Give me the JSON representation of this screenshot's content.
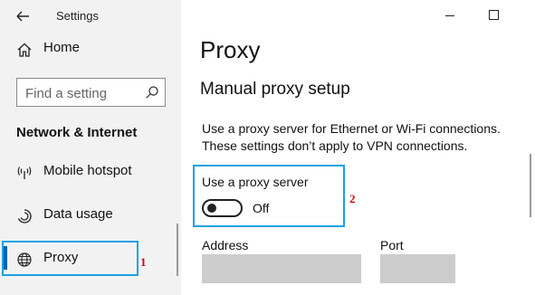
{
  "window": {
    "title": "Settings",
    "controls": {
      "minimize_icon": "minimize-icon",
      "maximize_icon": "maximize-icon"
    }
  },
  "sidebar": {
    "back_icon": "back-arrow-icon",
    "home": {
      "label": "Home",
      "icon": "home-icon"
    },
    "search": {
      "placeholder": "Find a setting",
      "icon": "search-icon"
    },
    "section": "Network & Internet",
    "items": [
      {
        "label": "Mobile hotspot",
        "icon": "hotspot-icon"
      },
      {
        "label": "Data usage",
        "icon": "data-usage-icon"
      },
      {
        "label": "Proxy",
        "icon": "globe-icon",
        "selected": true
      }
    ]
  },
  "main": {
    "title": "Proxy",
    "subtitle": "Manual proxy setup",
    "description_line1": "Use a proxy server for Ethernet or Wi-Fi connections.",
    "description_line2": "These settings don’t apply to VPN connections.",
    "proxy_toggle": {
      "label": "Use a proxy server",
      "state": "Off",
      "on": false
    },
    "address": {
      "label": "Address",
      "value": ""
    },
    "port": {
      "label": "Port",
      "value": ""
    }
  },
  "annotations": {
    "marker1": "1",
    "marker2": "2"
  },
  "colors": {
    "accent": "#0063b1",
    "annotation_box": "#1ba1e2",
    "annotation_number": "#d40000",
    "sidebar_bg": "#f2f2f2"
  }
}
